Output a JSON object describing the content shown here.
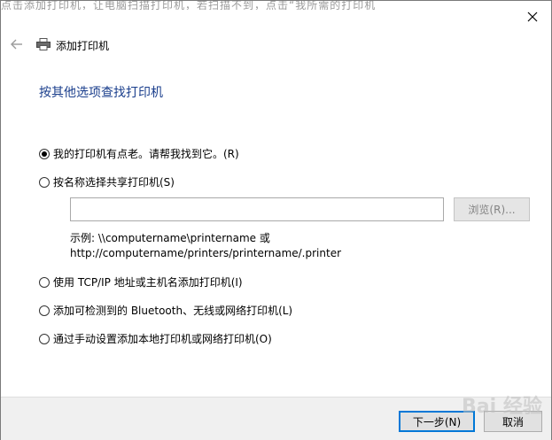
{
  "background_text": "点击添加打印机，让电脑扫描打印机，若扫描不到，点击“我所需的打印机",
  "window": {
    "title": "添加打印机",
    "heading": "按其他选项查找打印机"
  },
  "options": [
    {
      "label": "我的打印机有点老。请帮我找到它。(R)",
      "selected": true
    },
    {
      "label": "按名称选择共享打印机(S)",
      "selected": false
    },
    {
      "label": "使用 TCP/IP 地址或主机名添加打印机(I)",
      "selected": false
    },
    {
      "label": "添加可检测到的 Bluetooth、无线或网络打印机(L)",
      "selected": false
    },
    {
      "label": "通过手动设置添加本地打印机或网络打印机(O)",
      "selected": false
    }
  ],
  "share_name": {
    "value": "",
    "browse_label": "浏览(R)...",
    "example_line1": "示例: \\\\computername\\printername 或",
    "example_line2": "http://computername/printers/printername/.printer"
  },
  "footer": {
    "next_label": "下一步(N)",
    "cancel_label": "取消"
  },
  "watermark_text": "Bai 经验",
  "colors": {
    "heading": "#1a3e8c",
    "accent": "#0078d7",
    "footer_bg": "#f0f0f0"
  }
}
